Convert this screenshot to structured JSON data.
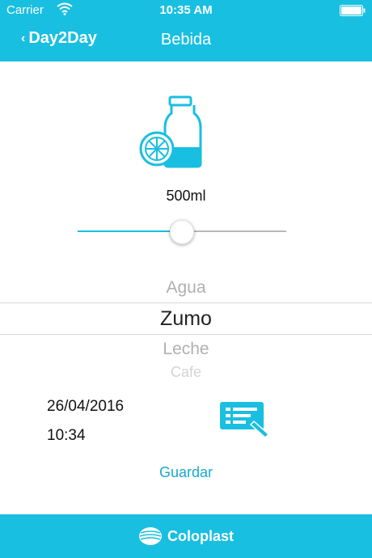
{
  "status_bar": {
    "carrier": "Carrier",
    "time": "10:35 AM"
  },
  "nav": {
    "back_label": "Day2Day",
    "title": "Bebida"
  },
  "drink": {
    "volume": "500ml",
    "volume_level": 0.5
  },
  "picker": {
    "options": [
      "Agua",
      "Zumo",
      "Leche",
      "Cafe"
    ],
    "selected": "Zumo"
  },
  "datetime": {
    "date": "26/04/2016",
    "time": "10:34"
  },
  "actions": {
    "save_label": "Guardar"
  },
  "footer": {
    "brand": "Coloplast"
  },
  "colors": {
    "accent": "#18bfe0",
    "link": "#18a9cf"
  },
  "icons": [
    "wifi-icon",
    "battery-icon",
    "chevron-left-icon",
    "bottle-icon",
    "edit-list-icon",
    "coloplast-logo-icon"
  ]
}
